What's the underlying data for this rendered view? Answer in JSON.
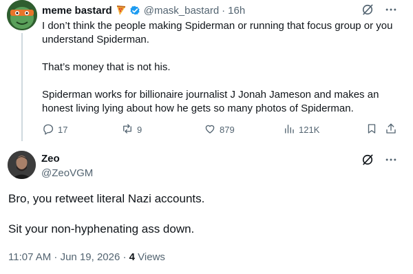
{
  "quoted_tweet": {
    "display_name": "meme bastard",
    "handle": "@mask_bastard",
    "separator": "·",
    "time_ago": "16h",
    "paragraphs": [
      "I don’t think the people making Spiderman or running that focus group or you understand Spiderman.",
      "That’s money that is not his.",
      "Spiderman works for billionaire journalist J Jonah Jameson and makes an honest living lying about how he gets so many photos of Spiderman."
    ],
    "stats": {
      "replies": "17",
      "reposts": "9",
      "likes": "879",
      "views": "121K"
    },
    "icons": [
      "grok-icon",
      "more-icon",
      "reply-icon",
      "repost-icon",
      "like-icon",
      "views-icon",
      "bookmark-icon",
      "share-icon"
    ]
  },
  "main_tweet": {
    "display_name": "Zeo",
    "handle": "@ZeoVGM",
    "paragraphs": [
      "Bro, you retweet literal Nazi accounts.",
      "Sit your non-hyphenating ass down."
    ],
    "timestamp": "11:07 AM · Jun 19, 2026 · ",
    "views_count": "4",
    "views_label": " Views"
  },
  "colors": {
    "text": "#0f1419",
    "muted": "#536471",
    "verified": "#1d9bf0",
    "thread_line": "#cfd9de"
  }
}
